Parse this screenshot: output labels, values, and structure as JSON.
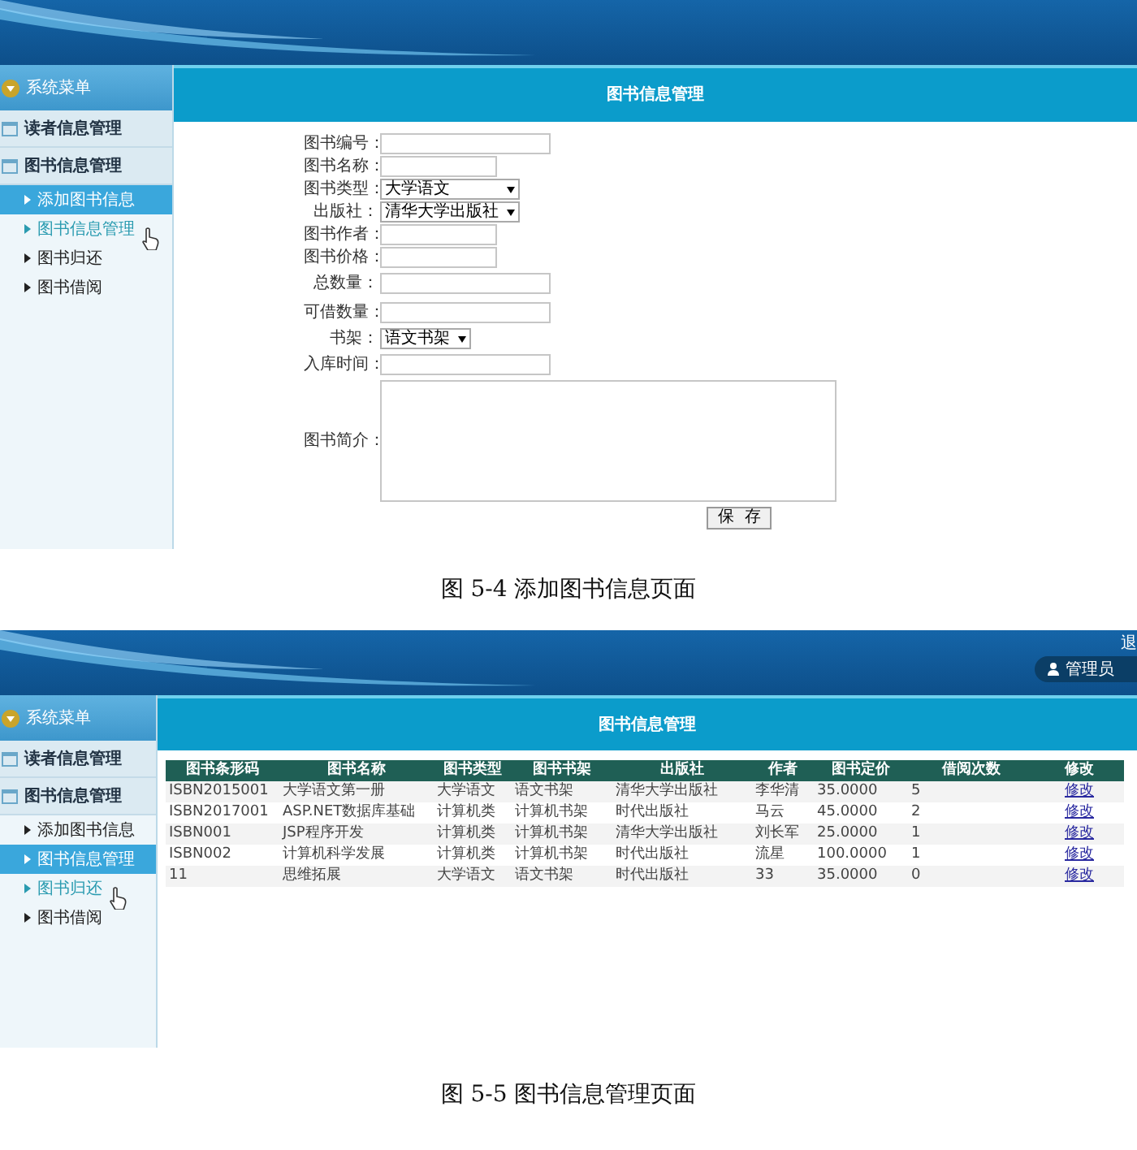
{
  "screen_1": {
    "sidebar": {
      "header": "系统菜单",
      "groups": [
        {
          "label": "读者信息管理"
        },
        {
          "label": "图书信息管理",
          "children": [
            {
              "label": "添加图书信息",
              "selected": true,
              "hovered": false
            },
            {
              "label": "图书信息管理",
              "selected": false,
              "hovered": true
            },
            {
              "label": "图书归还",
              "selected": false,
              "hovered": false
            },
            {
              "label": "图书借阅",
              "selected": false,
              "hovered": false
            }
          ]
        }
      ]
    },
    "title": "图书信息管理",
    "form": {
      "fields": [
        {
          "label": "图书编号：",
          "kind": "text"
        },
        {
          "label": "图书名称：",
          "kind": "short_text"
        },
        {
          "label": "图书类型：",
          "kind": "select",
          "value": "大学语文"
        },
        {
          "label": "出版社：",
          "kind": "select",
          "value": "清华大学出版社"
        },
        {
          "label": "图书作者：",
          "kind": "short_text"
        },
        {
          "label": "图书价格：",
          "kind": "short_text"
        },
        {
          "label": "总数量：",
          "kind": "text"
        },
        {
          "label": "可借数量：",
          "kind": "text"
        },
        {
          "label": "书架：",
          "kind": "small_select",
          "value": "语文书架"
        },
        {
          "label": "入库时间：",
          "kind": "text"
        },
        {
          "label": "图书简介：",
          "kind": "textarea"
        }
      ],
      "save_button": "保  存"
    }
  },
  "caption_1": "图 5-4 添加图书信息页面",
  "screen_2": {
    "logout_text": "退",
    "user_badge": "管理员",
    "sidebar": {
      "header": "系统菜单",
      "groups": [
        {
          "label": "读者信息管理"
        },
        {
          "label": "图书信息管理",
          "children": [
            {
              "label": "添加图书信息",
              "selected": false,
              "hovered": false
            },
            {
              "label": "图书信息管理",
              "selected": true,
              "hovered": false
            },
            {
              "label": "图书归还",
              "selected": false,
              "hovered": true
            },
            {
              "label": "图书借阅",
              "selected": false,
              "hovered": false
            }
          ]
        }
      ]
    },
    "title": "图书信息管理",
    "table": {
      "columns": [
        "图书条形码",
        "图书名称",
        "图书类型",
        "图书书架",
        "出版社",
        "作者",
        "图书定价",
        "借阅次数",
        "修改"
      ],
      "rows": [
        [
          "ISBN2015001",
          "大学语文第一册",
          "大学语文",
          "语文书架",
          "清华大学出版社",
          "李华清",
          "35.0000",
          "5",
          "修改"
        ],
        [
          "ISBN2017001",
          "ASP.NET数据库基础",
          "计算机类",
          "计算机书架",
          "时代出版社",
          "马云",
          "45.0000",
          "2",
          "修改"
        ],
        [
          "ISBN001",
          "JSP程序开发",
          "计算机类",
          "计算机书架",
          "清华大学出版社",
          "刘长军",
          "25.0000",
          "1",
          "修改"
        ],
        [
          "ISBN002",
          "计算机科学发展",
          "计算机类",
          "计算机书架",
          "时代出版社",
          "流星",
          "100.0000",
          "1",
          "修改"
        ],
        [
          "11",
          "思维拓展",
          "大学语文",
          "语文书架",
          "时代出版社",
          "33",
          "35.0000",
          "0",
          "修改"
        ]
      ]
    }
  },
  "caption_2": "图 5-5 图书信息管理页面"
}
